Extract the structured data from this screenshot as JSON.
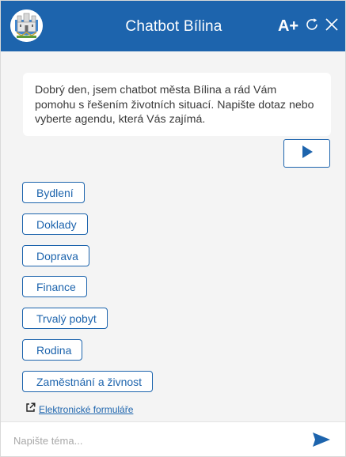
{
  "header": {
    "title": "Chatbot Bílina",
    "font_size_label": "A+",
    "refresh_icon": "refresh-icon",
    "close_icon": "close-icon",
    "logo_icon": "city-crest-logo"
  },
  "messages": {
    "bot_text": "Dobrý den, jsem chatbot města Bílina a rád Vám pomohu s řešením životních situací. Napište dotaz nebo vyberte agendu, která Vás zajímá.",
    "play_icon": "play-icon"
  },
  "topics": [
    {
      "label": "Bydlení"
    },
    {
      "label": "Doklady"
    },
    {
      "label": "Doprava"
    },
    {
      "label": "Finance"
    },
    {
      "label": "Trvalý pobyt"
    },
    {
      "label": "Rodina"
    },
    {
      "label": "Zaměstnání a živnost"
    }
  ],
  "forms_link": {
    "label": "Elektronické formuláře",
    "icon": "external-link-icon"
  },
  "composer": {
    "placeholder": "Napište téma...",
    "value": "",
    "send_icon": "send-icon"
  },
  "colors": {
    "brand": "#1d64ad",
    "background": "#f4f4f4",
    "text": "#3a3a3a"
  }
}
